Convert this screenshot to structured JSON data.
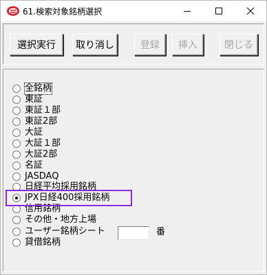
{
  "window": {
    "title": "61.検索対象銘柄選択",
    "controls": {
      "minimize": "minimize",
      "maximize": "maximize",
      "close": "close"
    }
  },
  "toolbar": {
    "execute_label": "選択実行",
    "cancel_label": "取り消し",
    "register_label": "登録",
    "insert_label": "挿入",
    "close_label": "閉じる"
  },
  "options": [
    {
      "label": "全銘柄",
      "checked": false
    },
    {
      "label": "東証",
      "checked": false
    },
    {
      "label": "東証１部",
      "checked": false
    },
    {
      "label": "東証2部",
      "checked": false
    },
    {
      "label": "大証",
      "checked": false
    },
    {
      "label": "大証１部",
      "checked": false
    },
    {
      "label": "大証2部",
      "checked": false
    },
    {
      "label": "名証",
      "checked": false
    },
    {
      "label": "JASDAQ",
      "checked": false
    },
    {
      "label": "日経平均採用銘柄",
      "checked": false
    },
    {
      "label": "JPX日経400採用銘柄",
      "checked": true
    },
    {
      "label": "信用銘柄",
      "checked": false
    },
    {
      "label": "その他・地方上場",
      "checked": false
    },
    {
      "label": "ユーザー銘柄シート",
      "checked": false
    },
    {
      "label": "貸借銘柄",
      "checked": false
    }
  ],
  "sheet_number": {
    "value": "",
    "suffix": "番"
  },
  "colors": {
    "highlight": "#8a2be2",
    "disabled_text": "#a0a0a0",
    "face": "#f0f0f0"
  }
}
